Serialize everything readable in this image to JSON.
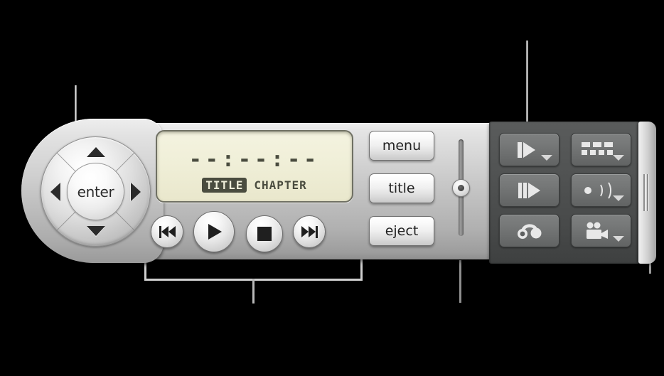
{
  "device": {
    "name": "DVD Player Controller",
    "shell_color": "#c0c0c0",
    "dark_panel_color": "#4e5050"
  },
  "dpad": {
    "enter_label": "enter",
    "up_icon": "arrow-up-icon",
    "down_icon": "arrow-down-icon",
    "left_icon": "arrow-left-icon",
    "right_icon": "arrow-right-icon"
  },
  "lcd": {
    "time": "--:--:--",
    "title_tag": "TITLE",
    "chapter_tag": "CHAPTER",
    "title_active": true,
    "background_color": "#f0efd8",
    "text_color": "#4a4c3f"
  },
  "transport": [
    {
      "name": "previous-chapter-button",
      "icon": "skip-back-icon"
    },
    {
      "name": "play-button",
      "icon": "play-icon"
    },
    {
      "name": "stop-button",
      "icon": "stop-icon"
    },
    {
      "name": "next-chapter-button",
      "icon": "skip-forward-icon"
    }
  ],
  "buttons": {
    "menu_label": "menu",
    "title_label": "title",
    "eject_label": "eject"
  },
  "slider": {
    "name": "volume-slider",
    "orientation": "vertical",
    "knob_position_percent": 42
  },
  "dark_panel_buttons": [
    {
      "name": "slow-motion-button",
      "icon": "slow-forward-icon",
      "has_dropdown": true
    },
    {
      "name": "subtitle-button",
      "icon": "subtitle-icon",
      "has_dropdown": true
    },
    {
      "name": "step-frame-button",
      "icon": "step-forward-icon",
      "has_dropdown": false
    },
    {
      "name": "audio-track-button",
      "icon": "audio-speaker-icon",
      "has_dropdown": true
    },
    {
      "name": "bookmark-button",
      "icon": "bookmark-loop-icon",
      "has_dropdown": false
    },
    {
      "name": "camera-angle-button",
      "icon": "video-camera-icon",
      "has_dropdown": true
    }
  ],
  "grip": {
    "name": "resize-grip-handle",
    "icon": "grip-lines-icon"
  },
  "callouts": [
    {
      "name": "callout-dpad",
      "target": "directional-pad"
    },
    {
      "name": "callout-transport",
      "target": "transport-controls"
    },
    {
      "name": "callout-slider",
      "target": "volume-slider"
    },
    {
      "name": "callout-dark-panel",
      "target": "extra-controls-panel"
    },
    {
      "name": "callout-grip",
      "target": "resize-grip-handle"
    }
  ]
}
